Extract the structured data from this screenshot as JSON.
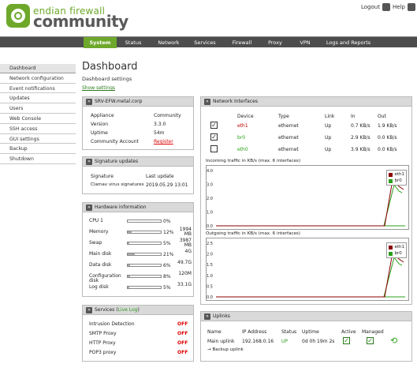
{
  "brand": {
    "line1": "endian firewall",
    "line2": "community"
  },
  "top": {
    "logout": "Logout",
    "help": "Help"
  },
  "nav": [
    {
      "label": "System"
    },
    {
      "label": "Status"
    },
    {
      "label": "Network"
    },
    {
      "label": "Services"
    },
    {
      "label": "Firewall"
    },
    {
      "label": "Proxy"
    },
    {
      "label": "VPN"
    },
    {
      "label": "Logs and Reports"
    }
  ],
  "sidebar": [
    {
      "label": "Dashboard"
    },
    {
      "label": "Network configuration"
    },
    {
      "label": "Event notifications"
    },
    {
      "label": "Updates"
    },
    {
      "label": "Users"
    },
    {
      "label": "Web Console"
    },
    {
      "label": "SSH access"
    },
    {
      "label": "GUI settings"
    },
    {
      "label": "Backup"
    },
    {
      "label": "Shutdown"
    }
  ],
  "page": {
    "title": "Dashboard",
    "settings_label": "Dashboard settings",
    "show_settings": "Show settings"
  },
  "system": {
    "title": "SRV-EFW.metal.corp",
    "rows": [
      {
        "k": "Appliance",
        "v": "Community"
      },
      {
        "k": "Version",
        "v": "3.3.0"
      },
      {
        "k": "Uptime",
        "v": "54m"
      },
      {
        "k": "Community Account",
        "v": "Register"
      }
    ]
  },
  "signatures": {
    "title": "Signature updates",
    "col1": "Signature",
    "col2": "Last update",
    "name": "Clamav virus signatures",
    "date": "2019.05.29 13:01"
  },
  "hardware": {
    "title": "Hardware information",
    "rows": [
      {
        "k": "CPU 1",
        "pct": "0%",
        "fill": 0,
        "size": ""
      },
      {
        "k": "Memory",
        "pct": "12%",
        "fill": 12,
        "size": "1994\nMB"
      },
      {
        "k": "Swap",
        "pct": "5%",
        "fill": 5,
        "size": "3987\nMB"
      },
      {
        "k": "Main disk",
        "pct": "21%",
        "fill": 21,
        "size": "4G"
      },
      {
        "k": "Data disk",
        "pct": "6%",
        "fill": 6,
        "size": "49.7G"
      },
      {
        "k": "Configuration\ndisk",
        "pct": "8%",
        "fill": 8,
        "size": "120M"
      },
      {
        "k": "Log disk",
        "pct": "5%",
        "fill": 5,
        "size": "33.1G"
      }
    ]
  },
  "services": {
    "title_prefix": "Services (",
    "live_log": "Live Log",
    "title_suffix": ")",
    "rows": [
      {
        "k": "Intrusion Detection",
        "v": "OFF"
      },
      {
        "k": "SMTP Proxy",
        "v": "OFF"
      },
      {
        "k": "HTTP Proxy",
        "v": "OFF"
      },
      {
        "k": "POP3 proxy",
        "v": "OFF"
      }
    ]
  },
  "network": {
    "title": "Network Interfaces",
    "headers": [
      "Device",
      "Type",
      "Link",
      "In",
      "Out"
    ],
    "rows": [
      {
        "checked": true,
        "device": "eth1",
        "color": "#c00000",
        "type": "ethernet",
        "link": "Up",
        "in": "0.7 KB/s",
        "out": "1.9 KB/s"
      },
      {
        "checked": true,
        "device": "br0",
        "color": "#2aa01a",
        "type": "ethernet",
        "link": "Up",
        "in": "2.9 KB/s",
        "out": "0.0 KB/s"
      },
      {
        "checked": false,
        "device": "eth0",
        "color": "#2aa01a",
        "type": "ethernet",
        "link": "Up",
        "in": "3.9 KB/s",
        "out": "0.0 KB/s"
      }
    ],
    "incoming_label": "Incoming traffic in KB/s (max. 6 interfaces)",
    "outgoing_label": "Outgoing traffic in KB/s (max. 6 interfaces)",
    "in_ticks": [
      "4.0",
      "3.0",
      "2.0",
      "1.0",
      "0.0"
    ],
    "out_ticks": [
      "2.5",
      "2.0",
      "1.5",
      "1.0",
      "0.5",
      "0.0"
    ],
    "legend": [
      {
        "name": "eth1",
        "color": "#8b0000"
      },
      {
        "name": "br0",
        "color": "#2aa01a"
      }
    ]
  },
  "uplinks": {
    "title": "Uplinks",
    "headers": [
      "Name",
      "IP Address",
      "Status",
      "Uptime",
      "Active",
      "Managed"
    ],
    "row": {
      "name": "Main uplink",
      "ip": "192.168.0.16",
      "status": "UP",
      "uptime": "0d 0h 19m 2s"
    },
    "backup": "→ Backup uplink"
  },
  "colors": {
    "accent": "#6ea82b",
    "nav_bg": "#4d4d4d",
    "off_red": "#d00000"
  }
}
